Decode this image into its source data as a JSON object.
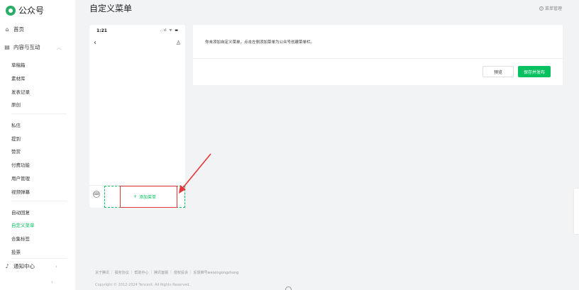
{
  "app": {
    "name": "公众号",
    "title": "自定义菜单",
    "menu_mgmt": "菜单管理"
  },
  "sidebar": {
    "home": "首页",
    "content": "内容与互动",
    "content_sub": [
      "草稿箱",
      "素材库",
      "发表记录",
      "原创"
    ],
    "interact_sub": [
      "私信",
      "提到",
      "赞赏",
      "付费功能",
      "用户管理",
      "视频弹幕"
    ],
    "menu_sub": [
      "自动回复",
      "自定义菜单",
      "合集标签",
      "投票"
    ],
    "notice": "通知中心"
  },
  "phone": {
    "time": "1:21",
    "status": "..ıl ᯤ ▬",
    "add_menu": "添加菜单"
  },
  "panel": {
    "hint": "你未添加自定义菜单，点击左侧添加菜单为公众号创建菜单栏。",
    "preview": "预览",
    "publish": "保存并发布"
  },
  "footer": {
    "links": [
      "关于腾讯",
      "服务协议",
      "帮助中心",
      "腾讯客服",
      "侵权投诉",
      "反馈推号weixingongzhong"
    ],
    "copyright": "Copyright © 2012-2024 Tencent. All Rights Reserved."
  },
  "colors": {
    "accent": "#07c160",
    "highlight": "#e8353a"
  }
}
